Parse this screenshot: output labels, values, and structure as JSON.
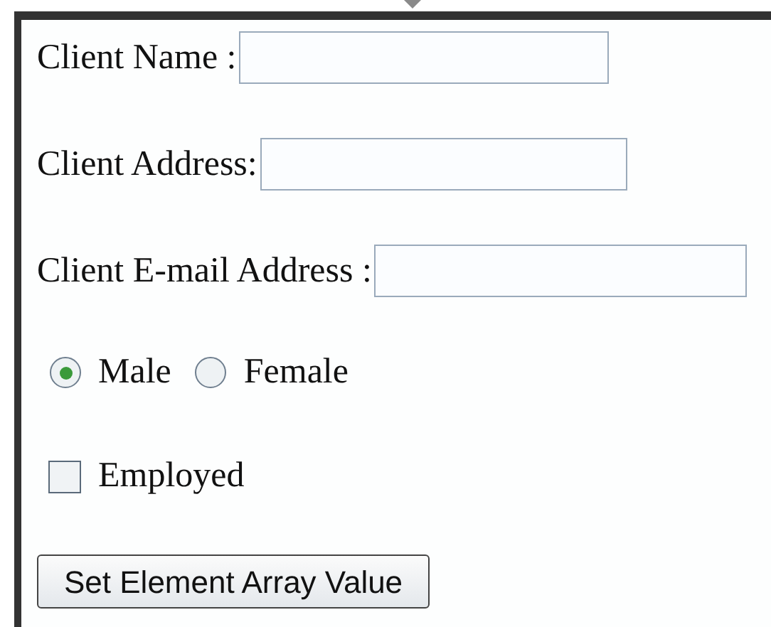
{
  "fields": [
    {
      "label": "Client Name :"
    },
    {
      "label": "Client Address:"
    },
    {
      "label": "Client E-mail Address :"
    }
  ],
  "gender": [
    {
      "label": "Male",
      "selected": true
    },
    {
      "label": "Female",
      "selected": false
    }
  ],
  "employed": {
    "label": "Employed",
    "checked": false
  },
  "button": {
    "label": "Set Element Array Value"
  }
}
